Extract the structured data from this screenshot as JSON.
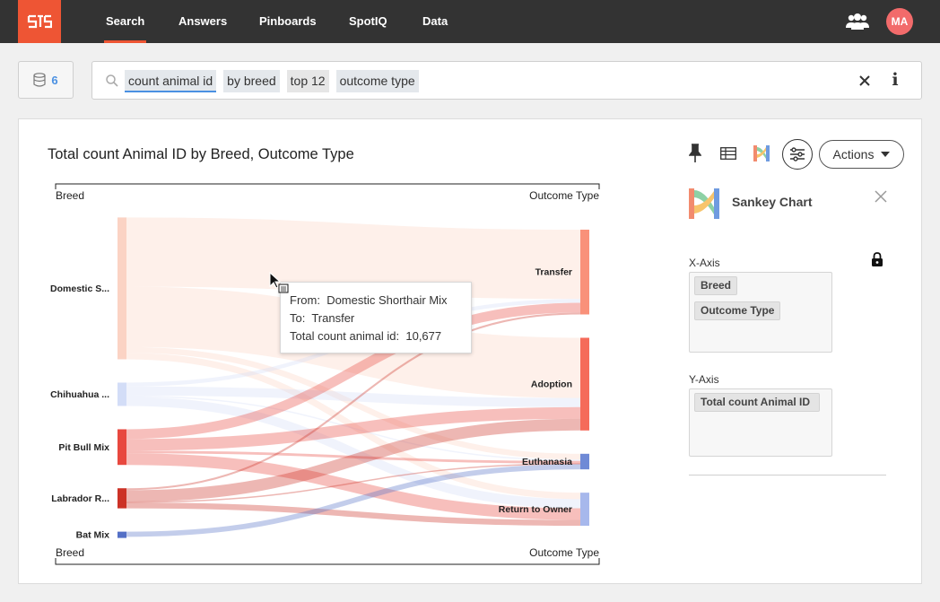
{
  "nav": {
    "items": [
      {
        "label": "Search",
        "active": true
      },
      {
        "label": "Answers"
      },
      {
        "label": "Pinboards"
      },
      {
        "label": "SpotIQ"
      },
      {
        "label": "Data"
      }
    ],
    "avatar_initials": "MA",
    "brand_color": "#ee5534"
  },
  "search": {
    "source_count": "6",
    "tokens": [
      "count animal id",
      "by breed",
      "top 12",
      "outcome type"
    ]
  },
  "chart": {
    "title": "Total count Animal ID by Breed, Outcome Type",
    "left_axis_label": "Breed",
    "right_axis_label": "Outcome Type"
  },
  "tooltip": {
    "from_label": "From:",
    "from_value": "Domestic Shorthair Mix",
    "to_label": "To:",
    "to_value": "Transfer",
    "measure_label": "Total count animal id:",
    "measure_value": "10,677"
  },
  "toolbar": {
    "actions_label": "Actions"
  },
  "config": {
    "chart_type": "Sankey Chart",
    "x_axis_label": "X-Axis",
    "x_axis_columns": [
      "Breed",
      "Outcome Type"
    ],
    "y_axis_label": "Y-Axis",
    "y_axis_columns": [
      "Total count Animal ID"
    ]
  },
  "chart_data": {
    "type": "sankey",
    "title": "Total count Animal ID by Breed, Outcome Type",
    "source_axis": "Breed",
    "target_axis": "Outcome Type",
    "sources": [
      {
        "label": "Domestic S...",
        "color": "#fbd3c4"
      },
      {
        "label": "Chihuahua ...",
        "color": "#d3ddf7"
      },
      {
        "label": "Pit Bull Mix",
        "color": "#e8483f"
      },
      {
        "label": "Labrador R...",
        "color": "#cc3226"
      },
      {
        "label": "Bat Mix",
        "color": "#5470c6"
      }
    ],
    "targets": [
      {
        "label": "Transfer",
        "color": "#f9917a"
      },
      {
        "label": "Adoption",
        "color": "#f56b5a"
      },
      {
        "label": "Euthanasia",
        "color": "#6f8ad6"
      },
      {
        "label": "Return to Owner",
        "color": "#a7b8ec"
      }
    ],
    "links": [
      {
        "source": "Domestic S...",
        "target": "Transfer",
        "value": 10677
      },
      {
        "source": "Domestic S...",
        "target": "Adoption",
        "value": 9300
      },
      {
        "source": "Domestic S...",
        "target": "Euthanasia",
        "value": 900
      },
      {
        "source": "Domestic S...",
        "target": "Return to Owner",
        "value": 1000
      },
      {
        "source": "Chihuahua ...",
        "target": "Transfer",
        "value": 600
      },
      {
        "source": "Chihuahua ...",
        "target": "Adoption",
        "value": 1400
      },
      {
        "source": "Chihuahua ...",
        "target": "Euthanasia",
        "value": 200
      },
      {
        "source": "Chihuahua ...",
        "target": "Return to Owner",
        "value": 1400
      },
      {
        "source": "Pit Bull Mix",
        "target": "Transfer",
        "value": 1500
      },
      {
        "source": "Pit Bull Mix",
        "target": "Adoption",
        "value": 1800
      },
      {
        "source": "Pit Bull Mix",
        "target": "Euthanasia",
        "value": 400
      },
      {
        "source": "Pit Bull Mix",
        "target": "Return to Owner",
        "value": 1800
      },
      {
        "source": "Labrador R...",
        "target": "Transfer",
        "value": 300
      },
      {
        "source": "Labrador R...",
        "target": "Adoption",
        "value": 1800
      },
      {
        "source": "Labrador R...",
        "target": "Euthanasia",
        "value": 100
      },
      {
        "source": "Labrador R...",
        "target": "Return to Owner",
        "value": 900
      },
      {
        "source": "Bat Mix",
        "target": "Euthanasia",
        "value": 800
      }
    ]
  }
}
